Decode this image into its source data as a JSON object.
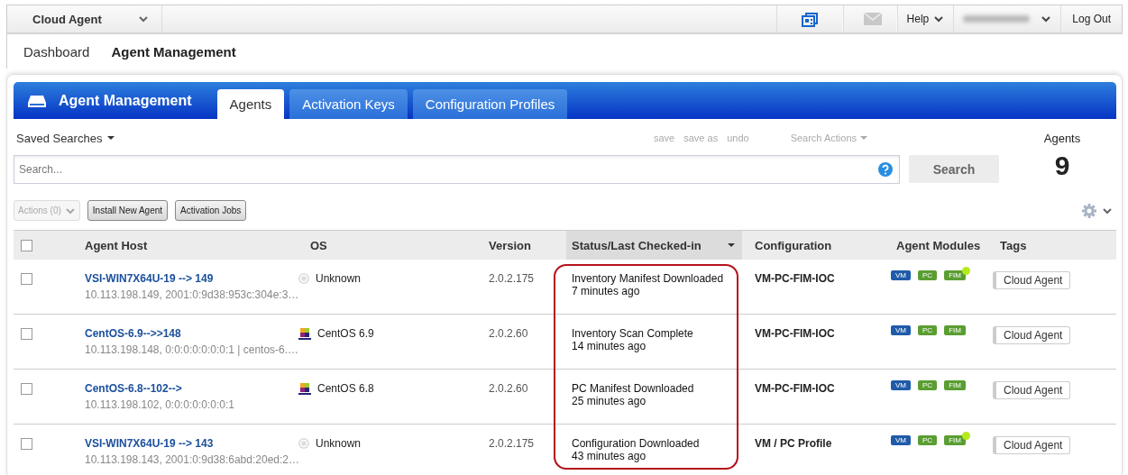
{
  "topbar": {
    "app_menu": "Cloud Agent",
    "help": "Help",
    "logout": "Log Out"
  },
  "nav": [
    {
      "label": "Dashboard",
      "selected": false
    },
    {
      "label": "Agent Management",
      "selected": true
    }
  ],
  "panel": {
    "title": "Agent Management",
    "tabs": [
      {
        "label": "Agents",
        "selected": true
      },
      {
        "label": "Activation Keys",
        "selected": false
      },
      {
        "label": "Configuration Profiles",
        "selected": false
      }
    ]
  },
  "search_bar": {
    "saved_searches": "Saved Searches",
    "links": [
      "save",
      "save as",
      "undo"
    ],
    "search_actions": "Search Actions",
    "placeholder": "Search...",
    "button": "Search",
    "count_label": "Agents",
    "count": "9"
  },
  "toolbar": {
    "actions": {
      "label": "Actions (0)",
      "disabled": true
    },
    "buttons": [
      "Install New Agent",
      "Activation Jobs"
    ]
  },
  "table": {
    "select_all": {
      "checked": false
    },
    "columns": [
      {
        "label": "Agent Host",
        "sorted": false,
        "highlighted": false
      },
      {
        "label": "OS",
        "sorted": false,
        "highlighted": false
      },
      {
        "label": "Version",
        "sorted": false,
        "highlighted": false
      },
      {
        "label": "Status/Last Checked-in",
        "sorted": true,
        "highlighted": true
      },
      {
        "label": "Configuration",
        "sorted": false,
        "highlighted": false
      },
      {
        "label": "Agent Modules",
        "sorted": false,
        "highlighted": false
      },
      {
        "label": "Tags",
        "sorted": false,
        "highlighted": false
      }
    ],
    "rows": [
      {
        "checked": false,
        "host": "VSI-WIN7X64U-19 --> 149",
        "addresses": "10.113.198.149, 2001:0:9d38:953c:304e:3…",
        "os": {
          "kind": "unknown",
          "label": "Unknown"
        },
        "version": "2.0.2.175",
        "status": "Inventory Manifest Downloaded",
        "checked_in": "7 minutes ago",
        "configuration": "VM-PC-FIM-IOC",
        "modules": [
          {
            "label": "VM",
            "color": "#1f5ba8",
            "alert": false
          },
          {
            "label": "PC",
            "color": "#5a9e32",
            "alert": false
          },
          {
            "label": "FIM",
            "color": "#5a9e32",
            "alert": true
          }
        ],
        "tag": "Cloud Agent"
      },
      {
        "checked": false,
        "host": "CentOS-6.9-->>148",
        "addresses": "10.113.198.148, 0:0:0:0:0:0:0:1 | centos-6.…",
        "os": {
          "kind": "centos",
          "label": "CentOS 6.9"
        },
        "version": "2.0.2.60",
        "status": "Inventory Scan Complete",
        "checked_in": "14 minutes ago",
        "configuration": "VM-PC-FIM-IOC",
        "modules": [
          {
            "label": "VM",
            "color": "#1f5ba8",
            "alert": false
          },
          {
            "label": "PC",
            "color": "#5a9e32",
            "alert": false
          },
          {
            "label": "FIM",
            "color": "#5a9e32",
            "alert": false
          }
        ],
        "tag": "Cloud Agent"
      },
      {
        "checked": false,
        "host": "CentOS-6.8--102-->",
        "addresses": "10.113.198.102, 0:0:0:0:0:0:0:1",
        "os": {
          "kind": "centos",
          "label": "CentOS 6.8"
        },
        "version": "2.0.2.60",
        "status": "PC Manifest Downloaded",
        "checked_in": "25 minutes ago",
        "configuration": "VM-PC-FIM-IOC",
        "modules": [
          {
            "label": "VM",
            "color": "#1f5ba8",
            "alert": false
          },
          {
            "label": "PC",
            "color": "#5a9e32",
            "alert": false
          },
          {
            "label": "FIM",
            "color": "#5a9e32",
            "alert": false
          }
        ],
        "tag": "Cloud Agent"
      },
      {
        "checked": false,
        "host": "VSI-WIN7X64U-19 --> 143",
        "addresses": "10.113.198.143, 2001:0:9d38:6abd:20ed:2…",
        "os": {
          "kind": "unknown",
          "label": "Unknown"
        },
        "version": "2.0.2.175",
        "status": "Configuration Downloaded",
        "checked_in": "43 minutes ago",
        "configuration": "VM / PC Profile",
        "modules": [
          {
            "label": "VM",
            "color": "#1f5ba8",
            "alert": false
          },
          {
            "label": "PC",
            "color": "#5a9e32",
            "alert": false
          },
          {
            "label": "FIM",
            "color": "#5a9e32",
            "alert": true
          }
        ],
        "tag": "Cloud Agent"
      }
    ]
  }
}
